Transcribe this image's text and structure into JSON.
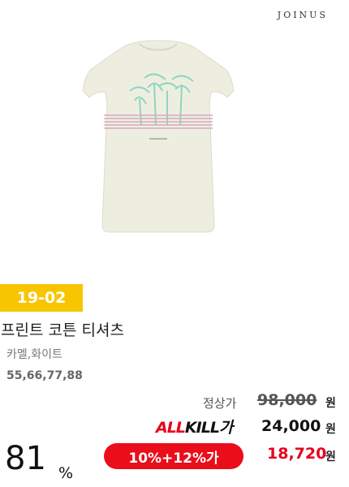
{
  "brand": "JOINUS",
  "product": {
    "image_icon": "white-tshirt-palm-print-image",
    "code": "19-02",
    "title": "프린트 코튼 티셔츠",
    "colors": "카멜,화이트",
    "sizes": "55,66,77,88"
  },
  "pricing": {
    "list_label": "정상가",
    "list_price": "98,000",
    "currency": "원",
    "allkill_red": "ALL",
    "allkill_dark": "KILL가",
    "allkill_price": "24,000",
    "discount_label": "10%+12%가",
    "final_price": "18,720",
    "rate": "81",
    "rate_unit": "%"
  },
  "colors": {
    "accent_red": "#e8001c",
    "badge_yellow": "#f7c600"
  }
}
